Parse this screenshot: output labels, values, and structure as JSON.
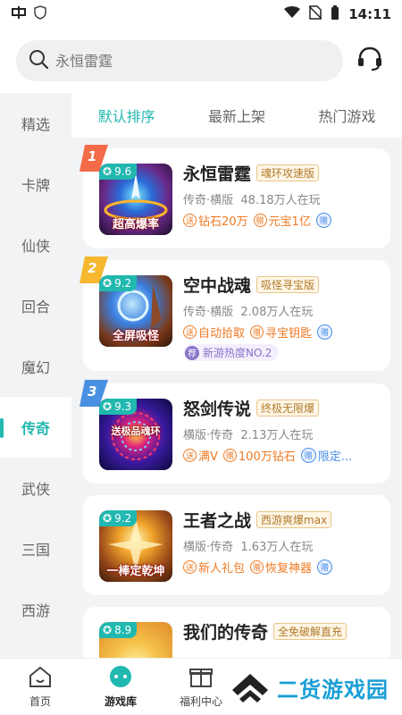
{
  "status": {
    "time": "14:11"
  },
  "search": {
    "placeholder": "永恒雷霆"
  },
  "sidebar": {
    "items": [
      {
        "label": "精选"
      },
      {
        "label": "卡牌"
      },
      {
        "label": "仙侠"
      },
      {
        "label": "回合"
      },
      {
        "label": "魔幻"
      },
      {
        "label": "传奇"
      },
      {
        "label": "武侠"
      },
      {
        "label": "三国"
      },
      {
        "label": "西游"
      }
    ],
    "active": "传奇"
  },
  "tabs": [
    {
      "label": "默认排序"
    },
    {
      "label": "最新上架"
    },
    {
      "label": "热门游戏"
    }
  ],
  "games": [
    {
      "rank": "1",
      "score": "9.6",
      "banner": "超高爆率",
      "title": "永恒雷霆",
      "tag": "魂环攻速版",
      "genre": "传奇·横版",
      "players": "48.18万人在玩",
      "perks": [
        {
          "icon": "送",
          "text": "钻石20万"
        },
        {
          "icon": "赠",
          "text": "元宝1亿"
        }
      ],
      "gift": "赠",
      "gift_text": ""
    },
    {
      "rank": "2",
      "score": "9.2",
      "banner": "全屏吸怪",
      "title": "空中战魂",
      "tag": "吸怪寻宝版",
      "genre": "传奇·横版",
      "players": "2.08万人在玩",
      "perks": [
        {
          "icon": "送",
          "text": "自动拾取"
        },
        {
          "icon": "赠",
          "text": "寻宝钥匙"
        }
      ],
      "gift": "赠",
      "gift_text": "",
      "rec_icon": "荐",
      "rec_text": "新游热度NO.2"
    },
    {
      "rank": "3",
      "score": "9.3",
      "banner": "送极品魂环",
      "title": "怒剑传说",
      "tag": "终极无限爆",
      "genre": "横版·传奇",
      "players": "2.13万人在玩",
      "perks": [
        {
          "icon": "送",
          "text": "满V"
        },
        {
          "icon": "赠",
          "text": "100万钻石"
        }
      ],
      "gift": "赠",
      "gift_text": "限定..."
    },
    {
      "rank": "",
      "score": "9.2",
      "banner": "一棒定乾坤",
      "title": "王者之战",
      "tag": "西游爽爆max",
      "genre": "横版·传奇",
      "players": "1.63万人在玩",
      "perks": [
        {
          "icon": "送",
          "text": "新人礼包"
        },
        {
          "icon": "赠",
          "text": "恢复神器"
        }
      ],
      "gift": "赠",
      "gift_text": ""
    },
    {
      "rank": "",
      "score": "8.9",
      "banner": "",
      "title": "我们的传奇",
      "tag": "全免破解直充",
      "genre": "",
      "players": "",
      "perks": [],
      "gift": "",
      "gift_text": ""
    }
  ],
  "bottom_nav": [
    {
      "label": "首页"
    },
    {
      "label": "游戏库"
    },
    {
      "label": "福利中心"
    }
  ],
  "watermark": "二货游戏园",
  "colors": {
    "accent": "#21b8b0",
    "orange": "#ee7a23",
    "gift_blue": "#4b8ee8"
  }
}
